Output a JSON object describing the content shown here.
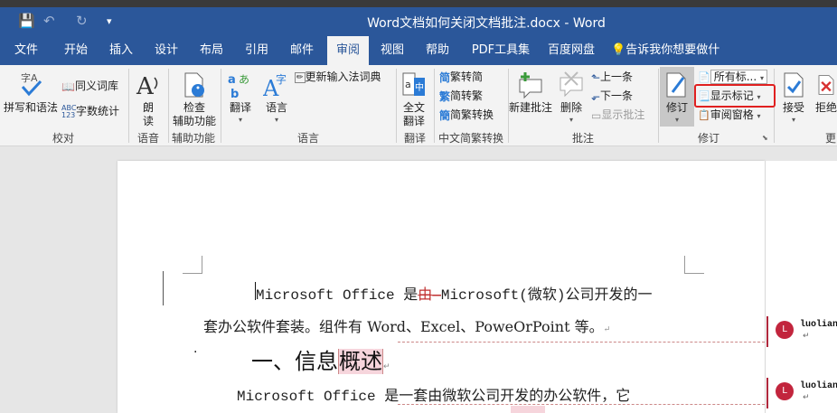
{
  "window": {
    "title": "Word文档如何关闭文档批注.docx  -  Word",
    "save_icon": "💾",
    "undo_icon": "↶",
    "redo_icon": "↻",
    "qat_more": "▾"
  },
  "tabs": [
    {
      "label": "文件"
    },
    {
      "label": "开始"
    },
    {
      "label": "插入"
    },
    {
      "label": "设计"
    },
    {
      "label": "布局"
    },
    {
      "label": "引用"
    },
    {
      "label": "邮件"
    },
    {
      "label": "审阅"
    },
    {
      "label": "视图"
    },
    {
      "label": "帮助"
    },
    {
      "label": "PDF工具集"
    },
    {
      "label": "百度网盘"
    },
    {
      "label": "告诉我你想要做什么"
    }
  ],
  "ribbon": {
    "spelling": "拼写和语法",
    "thesaurus": "同义词库",
    "wordcount": "字数统计",
    "read_aloud_1": "朗",
    "read_aloud_2": "读",
    "check_access_1": "检查",
    "check_access_2": "辅助功能",
    "translate": "翻译",
    "language": "语言",
    "update_ime": "更新输入法词典",
    "full_translate_1": "全文",
    "full_translate_2": "翻译",
    "to_simplified": "繁转简",
    "to_traditional": "简转繁",
    "conversion": "简繁转换",
    "new_comment": "新建批注",
    "delete": "删除",
    "prev": "上一条",
    "next": "下一条",
    "show_comments": "显示批注",
    "track": "修订",
    "all_markup": "所有标...",
    "show_markup": "显示标记",
    "review_pane": "审阅窗格",
    "accept": "接受",
    "reject": "拒绝",
    "groups": {
      "proofing": "校对",
      "speech": "语音",
      "accessibility": "辅助功能",
      "language": "语言",
      "translate": "翻译",
      "chinese": "中文简繁转换",
      "comments": "批注",
      "tracking": "修订",
      "changes": "更"
    }
  },
  "doc": {
    "p1_a": "Microsoft  Office 是",
    "p1_del": "由",
    "p1_b": "Microsoft(微软)公司开发的一",
    "p2": "套办公软件套装。组件有 Word、Excel、PoweOrPoint 等。",
    "p2_mark": "↵",
    "bullet": "·",
    "heading_a": "一、信息",
    "heading_hl": "概述",
    "heading_mark": "↵",
    "p3": "Microsoft  Office 是一套由微软公司开发的办公软件，它"
  },
  "comments": [
    {
      "avatar": "L",
      "author": "luolian",
      "mark": "↵"
    },
    {
      "avatar": "L",
      "author": "luolian",
      "mark": "↵"
    }
  ]
}
